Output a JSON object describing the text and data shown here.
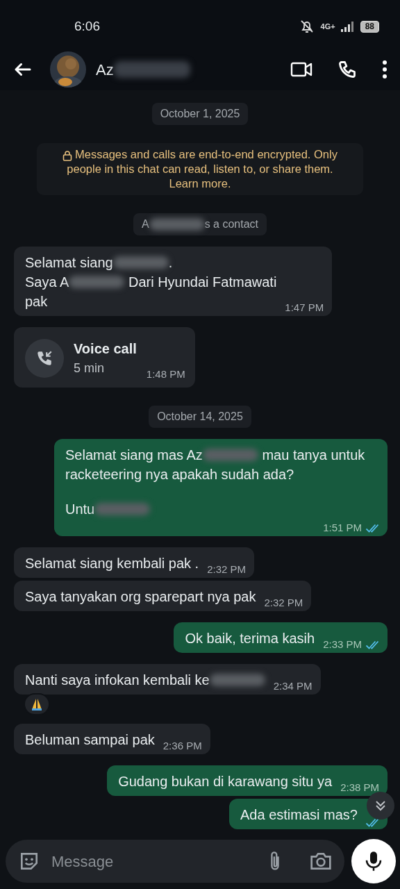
{
  "status_bar": {
    "time": "6:06",
    "network": "4G+",
    "battery": "88"
  },
  "header": {
    "contact_name": "Az",
    "name_redacted": true
  },
  "messages": [
    {
      "kind": "date",
      "text": "October 1, 2025"
    },
    {
      "kind": "notice",
      "text": "Messages and calls are end-to-end encrypted. Only people in this chat can read, listen to, or share them.",
      "link": "Learn more."
    },
    {
      "kind": "system",
      "parts": [
        {
          "kind": "text",
          "text": "A"
        },
        {
          "kind": "blur"
        },
        {
          "kind": "text",
          "text": "s a contact"
        }
      ]
    },
    {
      "kind": "text",
      "outgoing": false,
      "lines": [
        {
          "parts": [
            {
              "kind": "text",
              "text": "Selamat siang"
            },
            {
              "kind": "blur"
            },
            {
              "kind": "text",
              "text": "."
            }
          ]
        },
        {
          "parts": [
            {
              "kind": "text",
              "text": "Saya A"
            },
            {
              "kind": "blur"
            },
            {
              "kind": "text",
              "text": " Dari Hyundai Fatmawati"
            }
          ]
        },
        {
          "parts": [
            {
              "kind": "text",
              "text": "pak"
            }
          ]
        }
      ],
      "time": "1:47 PM"
    },
    {
      "kind": "call",
      "outgoing": false,
      "title": "Voice call",
      "duration": "5 min",
      "time": "1:48 PM"
    },
    {
      "kind": "date",
      "text": "October 14, 2025"
    },
    {
      "kind": "text",
      "outgoing": true,
      "lines": [
        {
          "spaced": false,
          "parts": [
            {
              "kind": "text",
              "text": "Selamat siang mas Az"
            },
            {
              "kind": "blur"
            },
            {
              "kind": "text",
              "text": " mau tanya untuk"
            }
          ]
        },
        {
          "spaced": false,
          "parts": [
            {
              "kind": "text",
              "text": "racketeering nya apakah sudah ada?"
            }
          ]
        },
        {
          "spaced": true,
          "parts": [
            {
              "kind": "text",
              "text": "Untu"
            },
            {
              "kind": "blur"
            }
          ]
        }
      ],
      "time": "1:51 PM",
      "read": true
    },
    {
      "kind": "text",
      "outgoing": false,
      "lines": [
        {
          "parts": [
            {
              "kind": "text",
              "text": "Selamat siang kembali pak ."
            }
          ]
        }
      ],
      "time": "2:32 PM"
    },
    {
      "kind": "text",
      "outgoing": false,
      "lines": [
        {
          "parts": [
            {
              "kind": "text",
              "text": "Saya tanyakan org sparepart nya pak"
            }
          ]
        }
      ],
      "time": "2:32 PM"
    },
    {
      "kind": "text",
      "outgoing": true,
      "lines": [
        {
          "parts": [
            {
              "kind": "text",
              "text": "Ok baik, terima kasih"
            }
          ]
        }
      ],
      "time": "2:33 PM",
      "read": true
    },
    {
      "kind": "text",
      "outgoing": false,
      "lines": [
        {
          "parts": [
            {
              "kind": "text",
              "text": "Nanti saya infokan kembali ke"
            },
            {
              "kind": "blur"
            }
          ]
        }
      ],
      "time": "2:34 PM",
      "reaction": true
    },
    {
      "kind": "text",
      "outgoing": false,
      "lines": [
        {
          "parts": [
            {
              "kind": "text",
              "text": "Beluman sampai pak"
            }
          ]
        }
      ],
      "time": "2:36 PM"
    },
    {
      "kind": "text",
      "outgoing": true,
      "lines": [
        {
          "parts": [
            {
              "kind": "text",
              "text": "Gudang bukan di karawang situ ya"
            }
          ]
        }
      ],
      "time": "2:38 PM"
    },
    {
      "kind": "text",
      "outgoing": true,
      "lines": [
        {
          "parts": [
            {
              "kind": "text",
              "text": "Ada estimasi mas?"
            }
          ]
        }
      ],
      "read": true
    }
  ],
  "composer": {
    "placeholder": "Message"
  }
}
